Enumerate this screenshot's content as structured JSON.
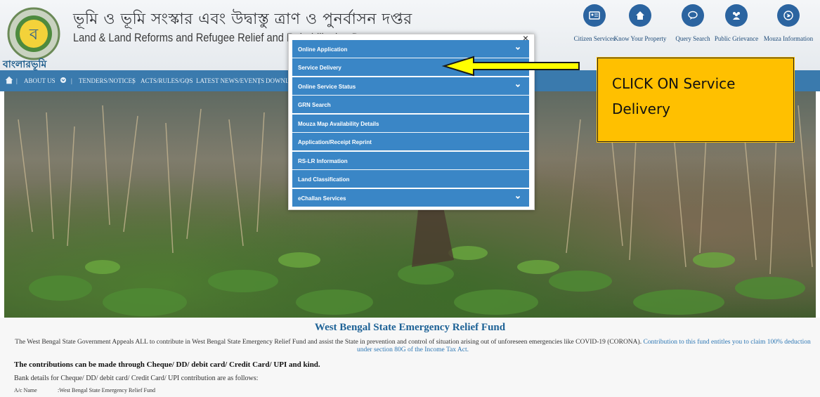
{
  "header": {
    "title_bengali": "ভূমি ও ভূমি সংস্কার এবং উদ্বাস্তু ত্রাণ ও পুনর্বাসন দপ্তর",
    "title_english": "Land & Land Reforms and Refugee Relief and Rehabilitation D",
    "logo_text": "বাংলারভূমি"
  },
  "quick_links": [
    {
      "label": "Citizen Services",
      "icon": "id-card-icon"
    },
    {
      "label": "Know Your Property",
      "icon": "home-icon"
    },
    {
      "label": "Query Search",
      "icon": "chat-icon"
    },
    {
      "label": "Public Grievance",
      "icon": "users-icon"
    },
    {
      "label": "Mouza Information",
      "icon": "globe-icon"
    }
  ],
  "nav": {
    "about_us": "ABOUT US",
    "tenders": "TENDERS/NOTICES",
    "acts": "ACTS/RULES/GOS",
    "news": "LATEST NEWS/EVENTS",
    "downloads": "DOWNL"
  },
  "modal": {
    "close": "×",
    "items": [
      {
        "label": "Online Application",
        "has_submenu": true
      },
      {
        "label": "Service Delivery",
        "has_submenu": false
      },
      {
        "label": "Online Service Status",
        "has_submenu": true
      },
      {
        "label": "GRN Search",
        "has_submenu": false
      },
      {
        "label": "Mouza Map Availability Details",
        "has_submenu": false
      },
      {
        "label": "Application/Receipt Reprint",
        "has_submenu": false
      },
      {
        "label": "RS-LR Information",
        "has_submenu": false
      },
      {
        "label": "Land Classification",
        "has_submenu": false
      },
      {
        "label": "eChallan Services",
        "has_submenu": true
      }
    ]
  },
  "callout": {
    "text": "CLICK ON Service Delivery",
    "color": "#ffc000"
  },
  "content": {
    "relief_title": "West Bengal State Emergency Relief Fund",
    "appeal_text": "The West Bengal State Government Appeals ALL to contribute in West Bengal State Emergency Relief Fund and assist the State in prevention and control of situation arising out of unforeseen emergencies like COVID-19 (CORONA).",
    "appeal_link": "Contribution to this fund entitles you to claim 100% deduction under section 80G of the Income Tax Act.",
    "contributions": "The contributions can be made through Cheque/ DD/ debit card/ Credit Card/ UPI and kind.",
    "bank_details": "Bank details for Cheque/ DD/ debit card/ Credit Card/ UPI contribution are as follows:",
    "ac_name_label": "A/c Name",
    "ac_name_value": ":West Bengal State Emergency Relief Fund"
  },
  "colors": {
    "nav": "#3a7aad",
    "menu_item": "#3a86c6",
    "title_link": "#1e6296"
  }
}
